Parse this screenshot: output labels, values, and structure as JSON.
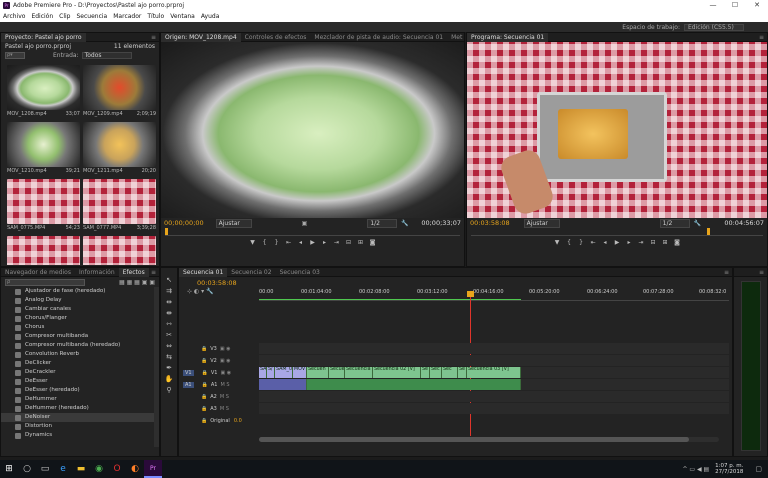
{
  "titlebar": {
    "title": "Adobe Premiere Pro - D:\\Proyectos\\Pastel ajo porro.prproj",
    "logo": "Pr",
    "minimize": "—",
    "maximize": "☐",
    "close": "✕"
  },
  "menu": [
    "Archivo",
    "Edición",
    "Clip",
    "Secuencia",
    "Marcador",
    "Título",
    "Ventana",
    "Ayuda"
  ],
  "workspace": {
    "label": "Espacio de trabajo:",
    "value": "Edición (CS5.5)"
  },
  "project": {
    "tab": "Proyecto: Pastel ajo porro",
    "project_file": "Pastel ajo porro.prproj",
    "item_count": "11 elementos",
    "entrada_label": "Entrada:",
    "entrada_value": "Todos",
    "items": [
      {
        "name": "MOV_1208.mp4",
        "duration": "33;07"
      },
      {
        "name": "MOV_1209.mp4",
        "duration": "2;09;19"
      },
      {
        "name": "MOV_1210.mp4",
        "duration": "39;21"
      },
      {
        "name": "MOV_1211.mp4",
        "duration": "20;20"
      },
      {
        "name": "SAM_0775.MP4",
        "duration": "54;23"
      },
      {
        "name": "SAM_0777.MP4",
        "duration": "3;39;28"
      },
      {
        "name": "",
        "duration": ""
      },
      {
        "name": "",
        "duration": ""
      }
    ]
  },
  "source": {
    "tabs": [
      "Origen: MOV_1208.mp4",
      "Controles de efectos",
      "Mezclador de pista de audio: Secuencia 01",
      "Met"
    ],
    "timecode_in": "00;00;00;00",
    "fit": "Ajustar",
    "resolution": "1/2",
    "duration": "00;00;33;07"
  },
  "program": {
    "tab": "Programa: Secuencia 01",
    "timecode": "00:03:58:08",
    "fit": "Ajustar",
    "resolution": "1/2",
    "duration": "00:04:56:07"
  },
  "effects": {
    "tabs": [
      "Navegador de medios",
      "Información",
      "Efectos"
    ],
    "items": [
      "Ajustador de fase (heredado)",
      "Analog Delay",
      "Cambiar canales",
      "Chorus/Flanger",
      "Chorus",
      "Compresor multibanda",
      "Compresor multibanda (heredado)",
      "Convolution Reverb",
      "DeClicker",
      "DeCrackler",
      "DeEsser",
      "DeEsser (heredado)",
      "DeHummer",
      "DeHummer (heredado)",
      "DeNoiser",
      "Distortion",
      "Dynamics"
    ]
  },
  "timeline": {
    "tabs": [
      "Secuencia 01",
      "Secuencia 02",
      "Secuencia 03"
    ],
    "timecode": "00:03:58:08",
    "ruler": [
      "00:00",
      "00:01:04:00",
      "00:02:08:00",
      "00:03:12:00",
      "00:04:16:00",
      "00:05:20:00",
      "00:06:24:00",
      "00:07:28:00",
      "00:08:32:0"
    ],
    "tracks": [
      "V3",
      "V2",
      "V1",
      "A1",
      "A2",
      "A3"
    ],
    "source_labels": {
      "v": "V1",
      "a": "A1"
    },
    "master": "Original",
    "master_value": "0.0",
    "video_clips": [
      "SA",
      "S/",
      "SAM_0",
      "MOV",
      "Secuen",
      "Secue",
      "Secuencia",
      "Secuencia 02 [V]",
      "Se",
      "Sec",
      "Sec",
      "Se",
      "Secuencia 03 [V]"
    ]
  },
  "taskbar": {
    "time": "1:07 p. m.",
    "date": "27/7/2018"
  }
}
